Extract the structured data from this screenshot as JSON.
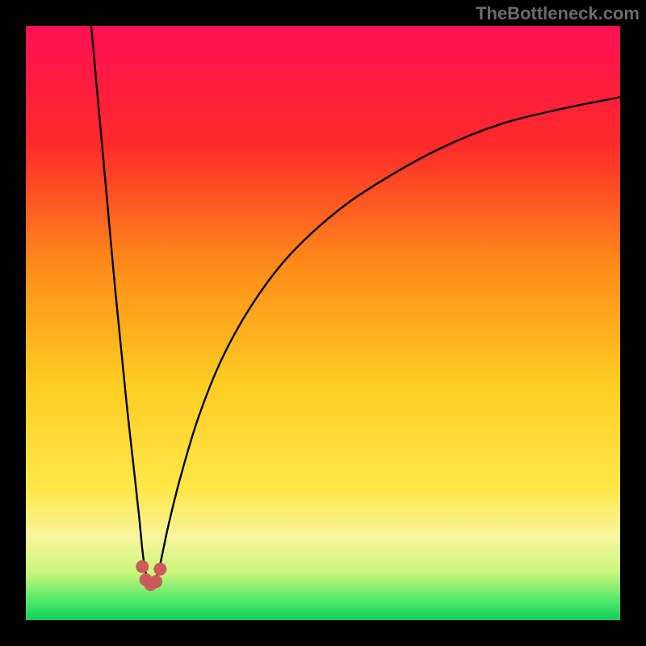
{
  "watermark": "TheBottleneck.com",
  "chart_data": {
    "type": "line",
    "title": "",
    "xlabel": "",
    "ylabel": "",
    "xlim": [
      0,
      100
    ],
    "ylim": [
      0,
      100
    ],
    "gradient_stops": [
      {
        "offset": 0,
        "color": "#ff1054"
      },
      {
        "offset": 20,
        "color": "#ff2a2a"
      },
      {
        "offset": 40,
        "color": "#ff8a1a"
      },
      {
        "offset": 60,
        "color": "#ffcc22"
      },
      {
        "offset": 78,
        "color": "#ffe84a"
      },
      {
        "offset": 86,
        "color": "#f8f59e"
      },
      {
        "offset": 92,
        "color": "#c9f67a"
      },
      {
        "offset": 97,
        "color": "#4be86a"
      },
      {
        "offset": 100,
        "color": "#10d05a"
      }
    ],
    "curve": {
      "dip_x": 21,
      "dip_y": 6,
      "left_start": {
        "x": 11,
        "y": 100
      },
      "right_end": {
        "x": 100,
        "y": 88
      },
      "points_left": [
        {
          "x": 11.0,
          "y": 100.0
        },
        {
          "x": 12.0,
          "y": 89.0
        },
        {
          "x": 13.0,
          "y": 78.0
        },
        {
          "x": 14.0,
          "y": 67.0
        },
        {
          "x": 15.0,
          "y": 56.0
        },
        {
          "x": 16.0,
          "y": 46.0
        },
        {
          "x": 17.0,
          "y": 36.0
        },
        {
          "x": 18.0,
          "y": 27.0
        },
        {
          "x": 19.0,
          "y": 18.0
        },
        {
          "x": 19.7,
          "y": 11.0
        },
        {
          "x": 20.3,
          "y": 7.5
        },
        {
          "x": 21.0,
          "y": 6.0
        }
      ],
      "points_right": [
        {
          "x": 21.0,
          "y": 6.0
        },
        {
          "x": 21.8,
          "y": 7.0
        },
        {
          "x": 22.5,
          "y": 9.0
        },
        {
          "x": 24.0,
          "y": 16.0
        },
        {
          "x": 26.0,
          "y": 24.0
        },
        {
          "x": 29.0,
          "y": 34.0
        },
        {
          "x": 33.0,
          "y": 44.0
        },
        {
          "x": 38.0,
          "y": 53.0
        },
        {
          "x": 44.0,
          "y": 61.0
        },
        {
          "x": 52.0,
          "y": 68.5
        },
        {
          "x": 60.0,
          "y": 74.0
        },
        {
          "x": 70.0,
          "y": 79.5
        },
        {
          "x": 80.0,
          "y": 83.5
        },
        {
          "x": 90.0,
          "y": 86.0
        },
        {
          "x": 100.0,
          "y": 88.0
        }
      ]
    },
    "dip_marker": {
      "color": "#cc5a5a",
      "points": [
        {
          "x": 19.6,
          "y": 9.0
        },
        {
          "x": 20.2,
          "y": 6.8
        },
        {
          "x": 21.0,
          "y": 6.0
        },
        {
          "x": 21.9,
          "y": 6.5
        },
        {
          "x": 22.6,
          "y": 8.6
        }
      ],
      "radius_px": 8
    }
  }
}
